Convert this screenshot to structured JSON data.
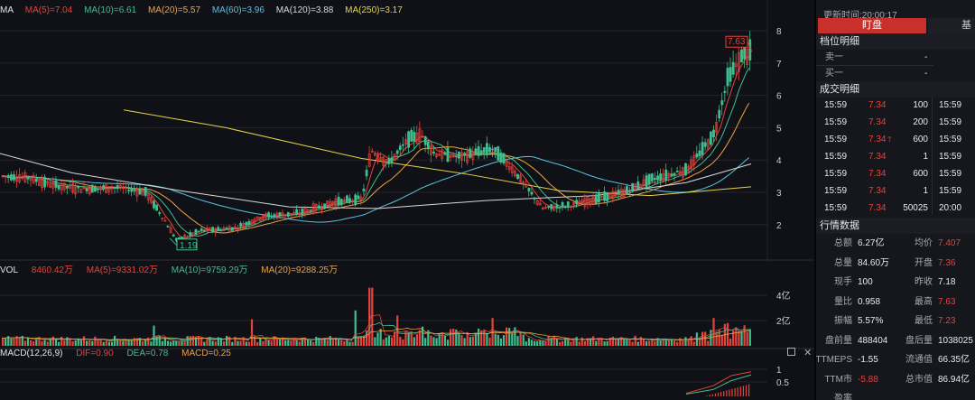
{
  "main_chart": {
    "indicator_label": "MA",
    "ma_values": [
      {
        "label": "MA(5)=7.04",
        "color": "#e5433b"
      },
      {
        "label": "MA(10)=6.61",
        "color": "#3fbf8f"
      },
      {
        "label": "MA(20)=5.57",
        "color": "#f0a33c"
      },
      {
        "label": "MA(60)=3.96",
        "color": "#59c3e0"
      },
      {
        "label": "MA(120)=3.88",
        "color": "#d8d8d8"
      },
      {
        "label": "MA(250)=3.17",
        "color": "#e8d34a"
      }
    ],
    "y_ticks": [
      "8",
      "7",
      "6",
      "5",
      "4",
      "3",
      "2"
    ],
    "high_marker": "7.63",
    "low_marker": "1.19"
  },
  "volume_chart": {
    "indicator_label": "VOL",
    "values": [
      {
        "label": "8460.42万",
        "color": "#e5433b"
      },
      {
        "label": "MA(5)=9331.02万",
        "color": "#e5433b"
      },
      {
        "label": "MA(10)=9759.29万",
        "color": "#3fbf8f"
      },
      {
        "label": "MA(20)=9288.25万",
        "color": "#f0a33c"
      }
    ],
    "y_ticks": [
      "4亿",
      "2亿"
    ]
  },
  "macd_chart": {
    "indicator_label": "MACD(12,26,9)",
    "values": [
      {
        "label": "DIF=0.90",
        "color": "#e5433b"
      },
      {
        "label": "DEA=0.78",
        "color": "#3fbf8f"
      },
      {
        "label": "MACD=0.25",
        "color": "#f0a33c"
      }
    ],
    "y_ticks": [
      "1",
      "0.5"
    ]
  },
  "panel": {
    "update_time": "更新时间:20:00:17",
    "tab_active": "盯盘",
    "tab_other": "基",
    "order_book_title": "档位明细",
    "sell1_label": "卖一",
    "sell1_value": "-",
    "buy1_label": "买一",
    "buy1_value": "-",
    "trades_title": "成交明细",
    "trades": [
      {
        "time": "15:59",
        "price": "7.34",
        "vol": "100",
        "time2": "15:59",
        "arrow": ""
      },
      {
        "time": "15:59",
        "price": "7.34",
        "vol": "200",
        "time2": "15:59",
        "arrow": ""
      },
      {
        "time": "15:59",
        "price": "7.34",
        "vol": "600",
        "time2": "15:59",
        "arrow": "🡑"
      },
      {
        "time": "15:59",
        "price": "7.34",
        "vol": "1",
        "time2": "15:59",
        "arrow": ""
      },
      {
        "time": "15:59",
        "price": "7.34",
        "vol": "600",
        "time2": "15:59",
        "arrow": ""
      },
      {
        "time": "15:59",
        "price": "7.34",
        "vol": "1",
        "time2": "15:59",
        "arrow": ""
      },
      {
        "time": "15:59",
        "price": "7.34",
        "vol": "50025",
        "time2": "20:00",
        "arrow": ""
      }
    ],
    "market_title": "行情数据",
    "market": [
      {
        "l1": "总额",
        "v1": "6.27亿",
        "c1": "white",
        "l2": "均价",
        "v2": "7.407",
        "c2": "red"
      },
      {
        "l1": "总量",
        "v1": "84.60万",
        "c1": "white",
        "l2": "开盘",
        "v2": "7.36",
        "c2": "red"
      },
      {
        "l1": "现手",
        "v1": "100",
        "c1": "white",
        "l2": "昨收",
        "v2": "7.18",
        "c2": "white"
      },
      {
        "l1": "量比",
        "v1": "0.958",
        "c1": "white",
        "l2": "最高",
        "v2": "7.63",
        "c2": "red"
      },
      {
        "l1": "振幅",
        "v1": "5.57%",
        "c1": "white",
        "l2": "最低",
        "v2": "7.23",
        "c2": "red"
      },
      {
        "l1": "盘前量",
        "v1": "488404",
        "c1": "white",
        "l2": "盘后量",
        "v2": "1038025",
        "c2": "white"
      },
      {
        "l1": "TTMEPS",
        "v1": "-1.55",
        "c1": "white",
        "l2": "流通值",
        "v2": "66.35亿",
        "c2": "white"
      },
      {
        "l1": "TTM市盈率",
        "v1": "-5.88",
        "c1": "red",
        "l2": "总市值",
        "v2": "86.94亿",
        "c2": "white"
      }
    ]
  }
}
